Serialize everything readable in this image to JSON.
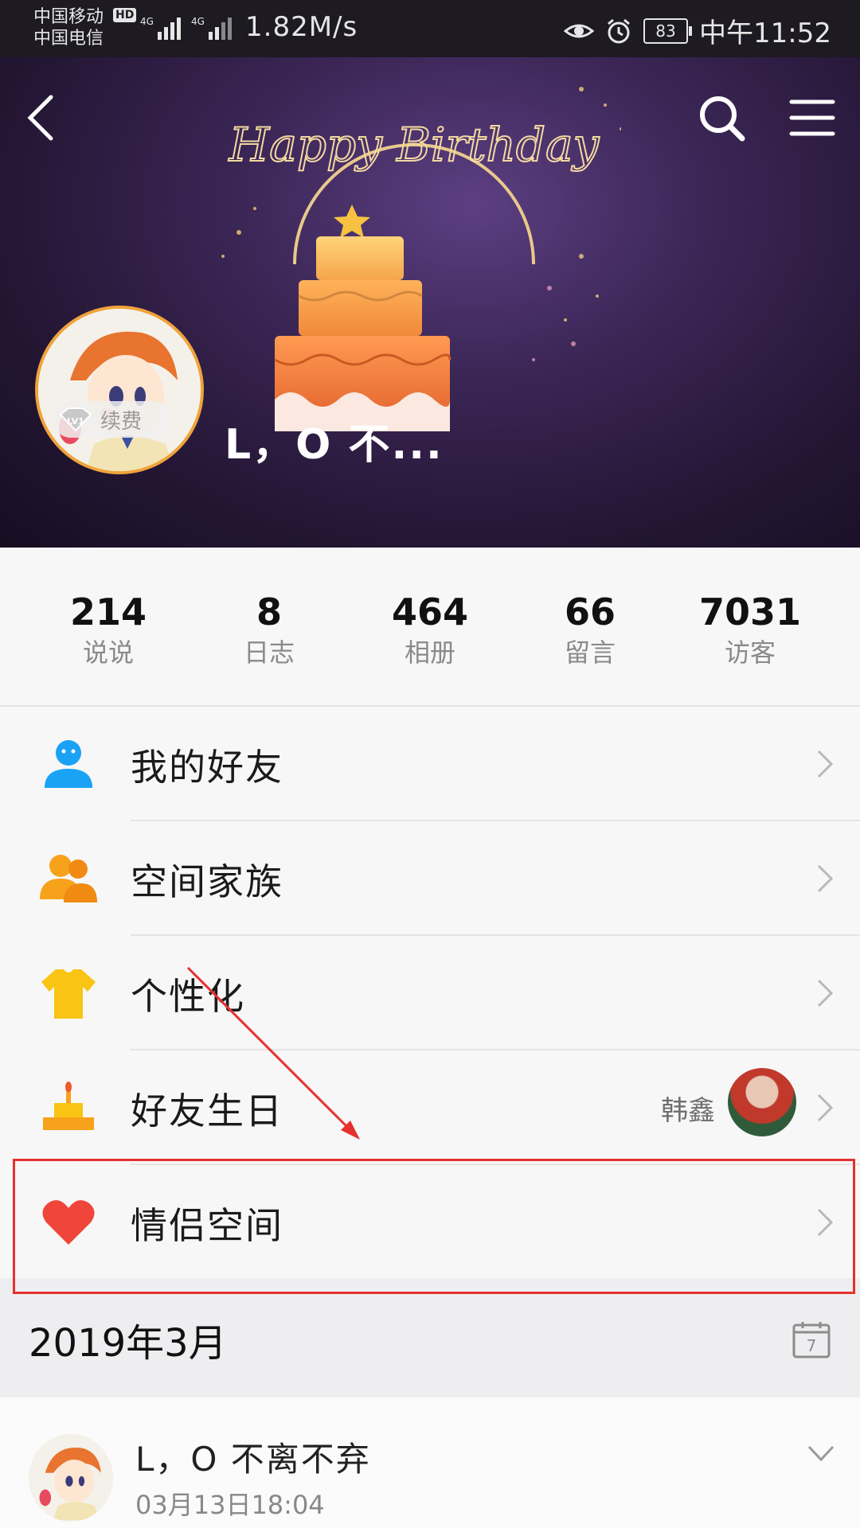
{
  "status_bar": {
    "carrier1": "中国移动",
    "carrier2": "中国电信",
    "hd": "HD",
    "net1": "4G",
    "net2": "4G",
    "speed": "1.82M/s",
    "battery": "83",
    "time": "中午11:52"
  },
  "profile": {
    "nickname": "L，O 不...",
    "level": "LV1",
    "renew_label": "续费",
    "banner_text": "Happy Birthday"
  },
  "stats": [
    {
      "value": "214",
      "label": "说说"
    },
    {
      "value": "8",
      "label": "日志"
    },
    {
      "value": "464",
      "label": "相册"
    },
    {
      "value": "66",
      "label": "留言"
    },
    {
      "value": "7031",
      "label": "访客"
    }
  ],
  "menu": [
    {
      "label": "我的好友",
      "icon": "friends-icon"
    },
    {
      "label": "空间家族",
      "icon": "family-icon"
    },
    {
      "label": "个性化",
      "icon": "tshirt-icon"
    },
    {
      "label": "好友生日",
      "icon": "birthday-cake-icon",
      "friend_name": "韩鑫"
    },
    {
      "label": "情侣空间",
      "icon": "heart-icon"
    }
  ],
  "timeline": {
    "date": "2019年3月"
  },
  "feed": {
    "name": "L，O 不离不弃",
    "time": "03月13日18:04"
  },
  "colors": {
    "accent_blue": "#1aa3f5",
    "accent_orange": "#f7a21b",
    "heart_red": "#f0453a",
    "highlight_red": "#e5312f"
  }
}
